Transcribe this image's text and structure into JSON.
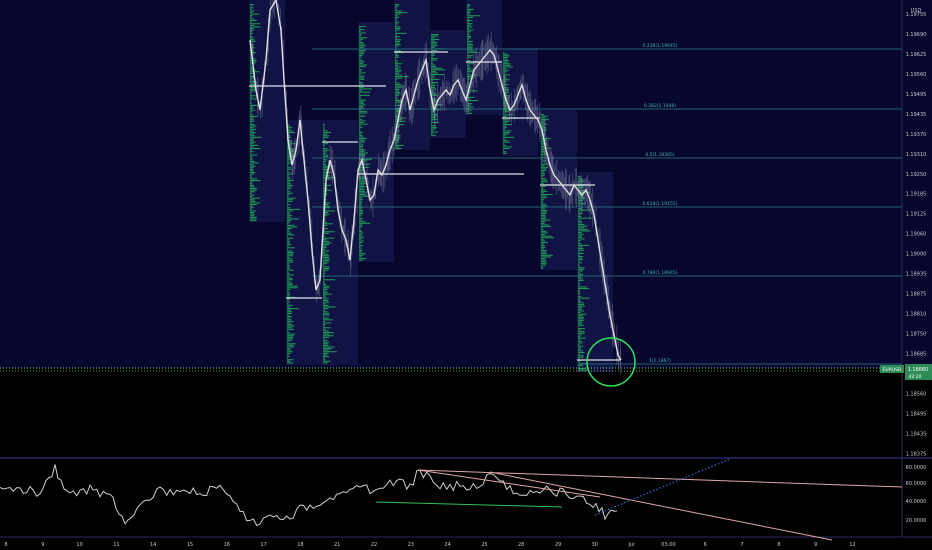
{
  "currency": "USD",
  "price_ticks": [
    "1.19755",
    "1.19690",
    "1.19625",
    "1.19560",
    "1.19495",
    "1.19435",
    "1.19370",
    "1.19310",
    "1.19250",
    "1.19185",
    "1.19125",
    "1.19060",
    "1.19000",
    "1.18935",
    "1.18875",
    "1.18810",
    "1.18750",
    "1.18685",
    "1.18625",
    "1.18560",
    "1.18495",
    "1.18435",
    "1.18375"
  ],
  "fib_levels": [
    "0.236(1.19645)",
    "0.382(1.1946)",
    "0.5(1.19305)",
    "0.618(1.19155)",
    "0.786(1.18945)",
    "1(1.1867)"
  ],
  "price_badge": {
    "label": "EURUSD",
    "price": "1.18660",
    "countdown": "42:20"
  },
  "osc_ticks": [
    "80.0000",
    "60.0000",
    "40.0000",
    "20.0000"
  ],
  "date_ticks": [
    "8",
    "9",
    "10",
    "11",
    "14",
    "15",
    "16",
    "17",
    "18",
    "21",
    "22",
    "23",
    "24",
    "25",
    "28",
    "29",
    "30",
    "Jul",
    "03:00",
    "6",
    "7",
    "8",
    "9",
    "12"
  ],
  "colors": {
    "background": "#000000",
    "upper_bg": "#07072d",
    "price_line": "#e0e0e0",
    "volume_profile": "#22c25a",
    "fib_line": "#2a7f8a",
    "fib_text": "#3fb3bd",
    "circle": "#2ee35a",
    "trendline": "#e0a9a9",
    "support_line": "#2ec25a",
    "projection": "#3f7fff",
    "axis_text": "#c8c8c8",
    "badge": "#2e8b57"
  }
}
